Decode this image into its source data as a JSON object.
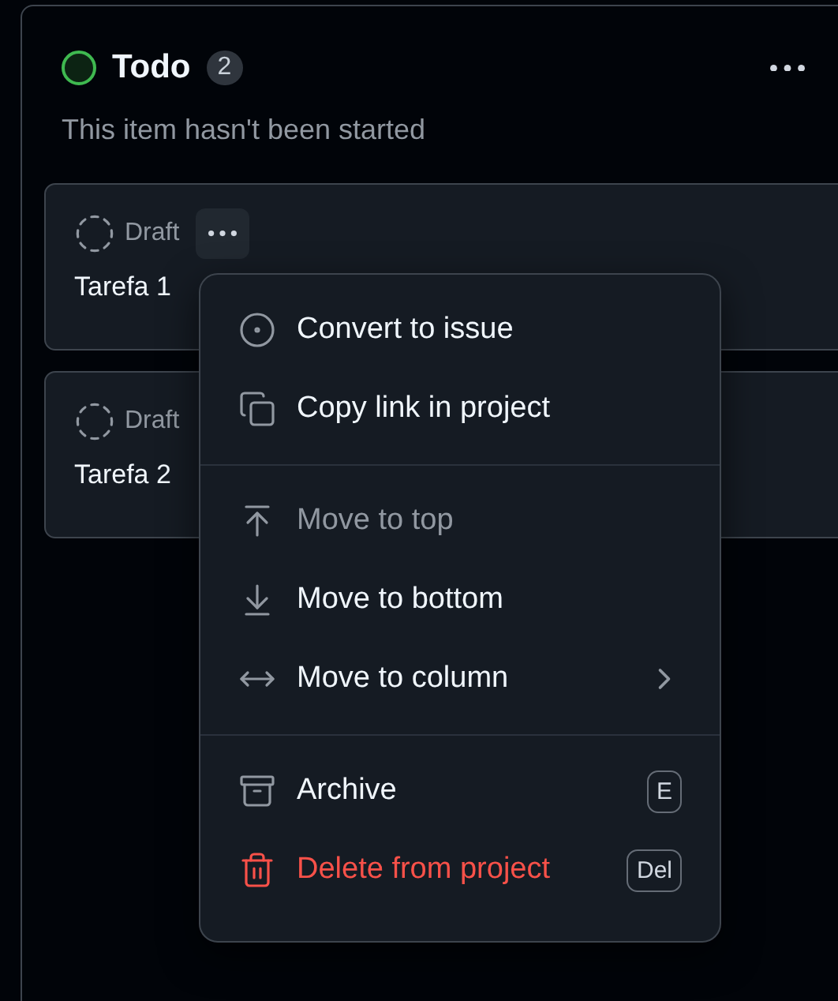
{
  "column": {
    "title": "Todo",
    "count": "2",
    "description": "This item hasn't been started"
  },
  "cards": [
    {
      "status": "Draft",
      "title": "Tarefa 1",
      "menu_open": true
    },
    {
      "status": "Draft",
      "title": "Tarefa 2",
      "menu_open": false
    }
  ],
  "context_menu": {
    "groups": [
      {
        "items": [
          {
            "kind": "convert",
            "label": "Convert to issue",
            "disabled": false,
            "danger": false
          },
          {
            "kind": "copy",
            "label": "Copy link in project",
            "disabled": false,
            "danger": false
          }
        ]
      },
      {
        "items": [
          {
            "kind": "top",
            "label": "Move to top",
            "disabled": true,
            "danger": false
          },
          {
            "kind": "bottom",
            "label": "Move to bottom",
            "disabled": false,
            "danger": false
          },
          {
            "kind": "column",
            "label": "Move to column",
            "disabled": false,
            "danger": false,
            "submenu": true
          }
        ]
      },
      {
        "items": [
          {
            "kind": "archive",
            "label": "Archive",
            "disabled": false,
            "danger": false,
            "shortcut": "E"
          },
          {
            "kind": "delete",
            "label": "Delete from project",
            "disabled": false,
            "danger": true,
            "shortcut": "Del"
          }
        ]
      }
    ]
  }
}
